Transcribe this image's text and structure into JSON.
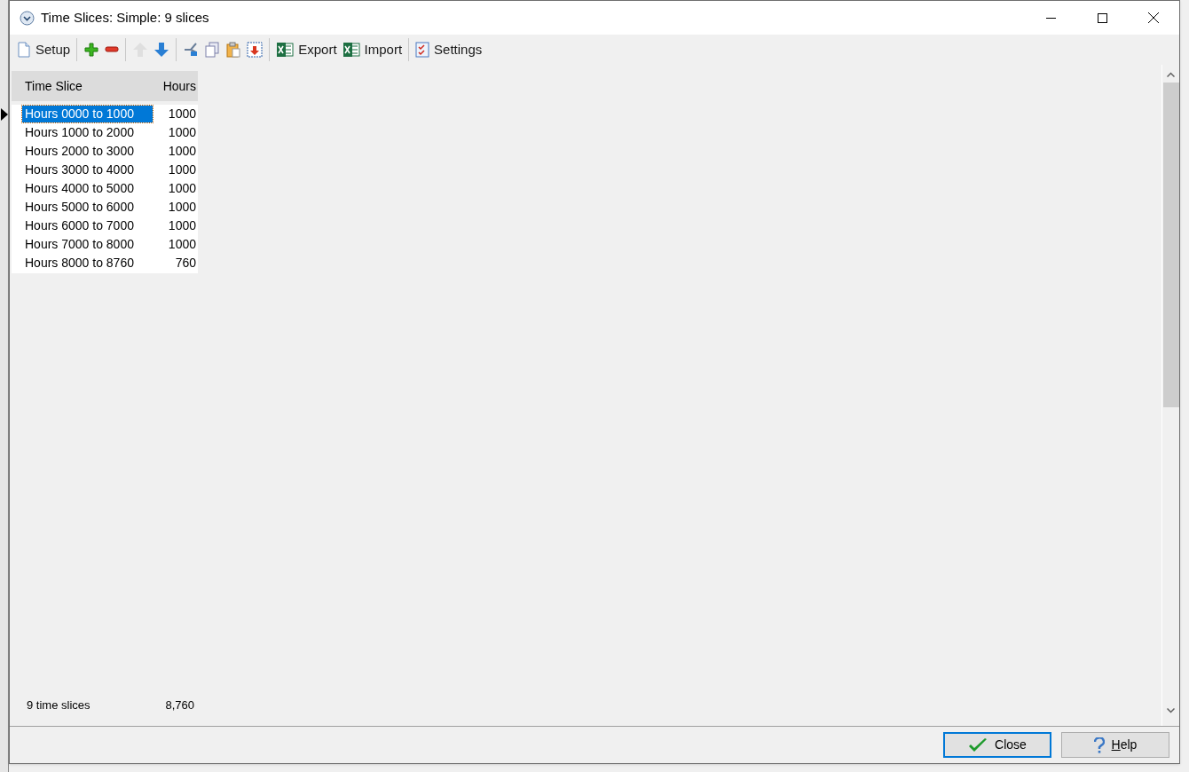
{
  "window": {
    "title": "Time Slices: Simple: 9 slices"
  },
  "toolbar": {
    "groups": [
      [
        {
          "label": "Setup",
          "disabled": false
        }
      ],
      [
        {
          "disabled": false
        },
        {
          "disabled": false
        }
      ],
      [
        {
          "disabled": true
        },
        {
          "disabled": false
        }
      ],
      [
        {
          "disabled": false
        },
        {
          "disabled": false
        },
        {
          "disabled": false
        },
        {
          "disabled": false
        }
      ],
      [
        {
          "label": "Export",
          "disabled": false
        },
        {
          "label": "Import",
          "disabled": false
        }
      ],
      [
        {
          "label": "Settings",
          "disabled": false
        }
      ]
    ]
  },
  "table": {
    "columns": [
      "Time Slice",
      "Hours"
    ],
    "rows": [
      {
        "slice": "Hours 0000 to 1000",
        "hours": "1000",
        "selected": true
      },
      {
        "slice": "Hours 1000 to 2000",
        "hours": "1000",
        "selected": false
      },
      {
        "slice": "Hours 2000 to 3000",
        "hours": "1000",
        "selected": false
      },
      {
        "slice": "Hours 3000 to 4000",
        "hours": "1000",
        "selected": false
      },
      {
        "slice": "Hours 4000 to 5000",
        "hours": "1000",
        "selected": false
      },
      {
        "slice": "Hours 5000 to 6000",
        "hours": "1000",
        "selected": false
      },
      {
        "slice": "Hours 6000 to 7000",
        "hours": "1000",
        "selected": false
      },
      {
        "slice": "Hours 7000 to 8000",
        "hours": "1000",
        "selected": false
      },
      {
        "slice": "Hours 8000 to 8760",
        "hours": "760",
        "selected": false
      }
    ],
    "footer": {
      "count": "9 time slices",
      "total": "8,760"
    }
  },
  "buttons": [
    {
      "label": "Close",
      "default": true,
      "mnemonic_underlined": false
    },
    {
      "label": "Help",
      "default": false,
      "mnemonic_underlined": true
    }
  ]
}
